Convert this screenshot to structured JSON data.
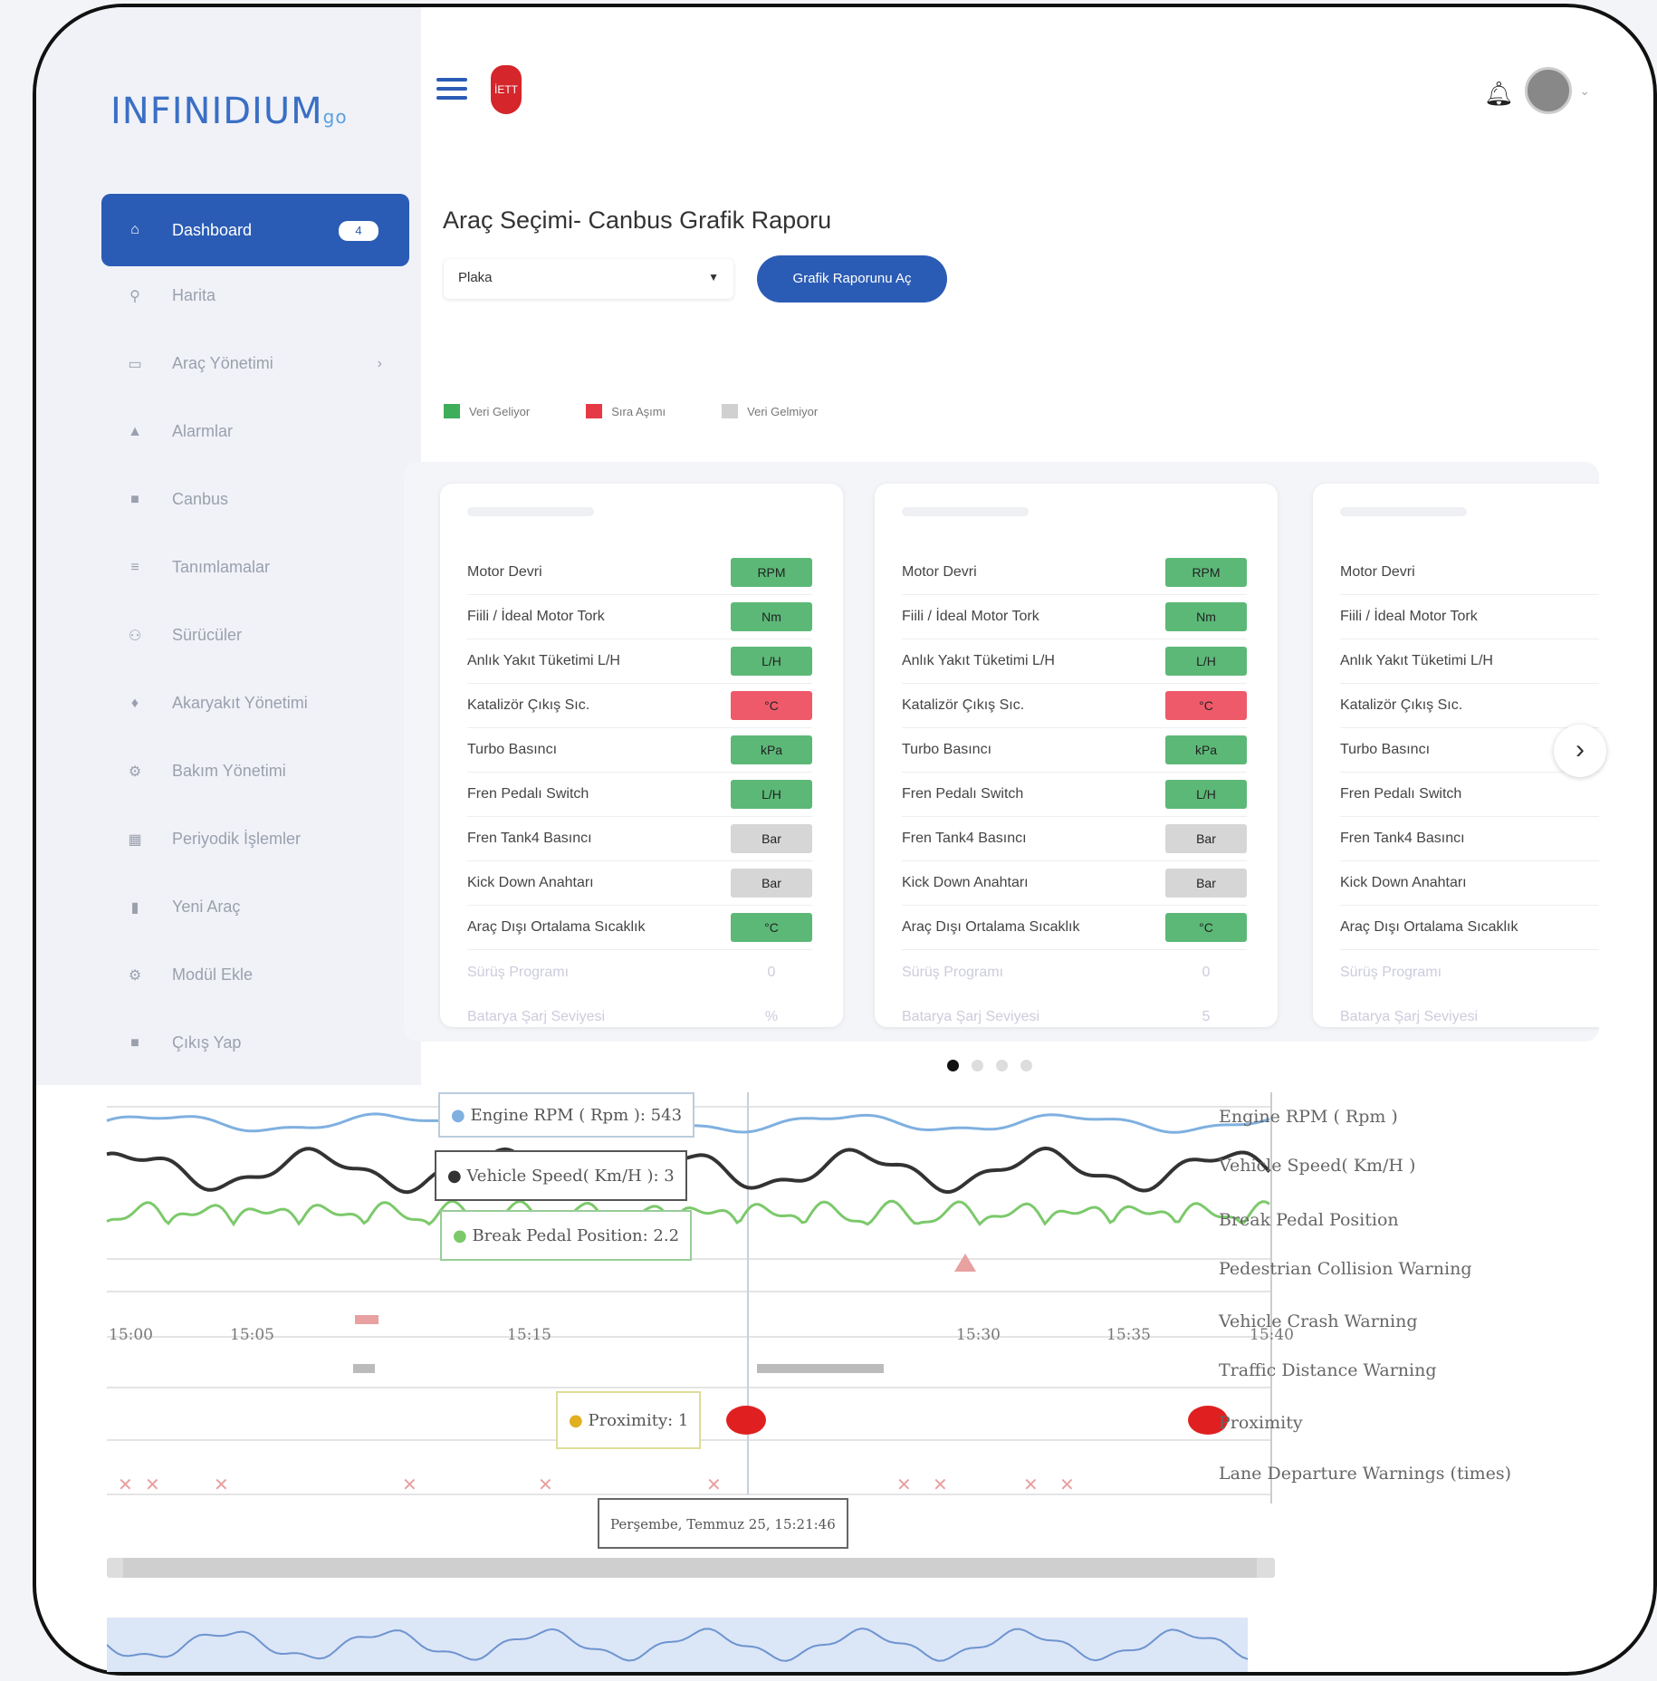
{
  "brand": {
    "logo_main": "INFINIDIUM",
    "logo_suffix": "go"
  },
  "sidebar": {
    "items": [
      {
        "label": "Dashboard",
        "icon": "home-icon",
        "badge": "4"
      },
      {
        "label": "Harita",
        "icon": "map-pin-icon"
      },
      {
        "label": "Araç Yönetimi",
        "icon": "vehicle-icon",
        "chevron": "›"
      },
      {
        "label": "Alarmlar",
        "icon": "alarm-icon"
      },
      {
        "label": "Canbus",
        "icon": "canbus-icon"
      },
      {
        "label": "Tanımlamalar",
        "icon": "list-icon"
      },
      {
        "label": "Sürücüler",
        "icon": "drivers-icon"
      },
      {
        "label": "Akaryakıt Yönetimi",
        "icon": "fuel-icon"
      },
      {
        "label": "Bakım Yönetimi",
        "icon": "maintenance-icon"
      },
      {
        "label": "Periyodik İşlemler",
        "icon": "calendar-icon"
      },
      {
        "label": "Yeni Araç",
        "icon": "new-vehicle-icon"
      },
      {
        "label": "Modül Ekle",
        "icon": "module-icon"
      },
      {
        "label": "Çıkış Yap",
        "icon": "logout-icon"
      }
    ]
  },
  "header": {
    "emblem_text": "İETT"
  },
  "page": {
    "title": "Araç Seçimi- Canbus Grafik Raporu",
    "plate_select": "Plaka",
    "open_button": "Grafik Raporunu Aç",
    "legend": [
      {
        "label": "Veri Geliyor",
        "color": "#3fae5a"
      },
      {
        "label": "Sıra Aşımı",
        "color": "#e63946"
      },
      {
        "label": "Veri Gelmiyor",
        "color": "#d0d0d0"
      }
    ]
  },
  "cards": [
    {
      "rows": [
        {
          "label": "Motor Devri",
          "unit": "RPM",
          "status": "green"
        },
        {
          "label": "Fiili / İdeal Motor Tork",
          "unit": "Nm",
          "status": "green"
        },
        {
          "label": "Anlık Yakıt Tüketimi L/H",
          "unit": "L/H",
          "status": "green"
        },
        {
          "label": "Katalizör Çıkış Sıc.",
          "unit": "°C",
          "status": "red"
        },
        {
          "label": "Turbo Basıncı",
          "unit": "kPa",
          "status": "green"
        },
        {
          "label": "Fren Pedalı Switch",
          "unit": "L/H",
          "status": "green"
        },
        {
          "label": "Fren Tank4 Basıncı",
          "unit": "Bar",
          "status": "gray"
        },
        {
          "label": "Kick Down Anahtarı",
          "unit": "Bar",
          "status": "gray"
        },
        {
          "label": "Araç Dışı Ortalama Sıcaklık",
          "unit": "°C",
          "status": "green"
        }
      ],
      "faded_rows": [
        {
          "label": "Sürüş Programı",
          "value": "0"
        },
        {
          "label": "Batarya Şarj Seviyesi",
          "value": "%"
        }
      ]
    },
    {
      "rows": [
        {
          "label": "Motor Devri",
          "unit": "RPM",
          "status": "green"
        },
        {
          "label": "Fiili / İdeal Motor Tork",
          "unit": "Nm",
          "status": "green"
        },
        {
          "label": "Anlık Yakıt Tüketimi L/H",
          "unit": "L/H",
          "status": "green"
        },
        {
          "label": "Katalizör Çıkış Sıc.",
          "unit": "°C",
          "status": "red"
        },
        {
          "label": "Turbo Basıncı",
          "unit": "kPa",
          "status": "green"
        },
        {
          "label": "Fren Pedalı Switch",
          "unit": "L/H",
          "status": "green"
        },
        {
          "label": "Fren Tank4 Basıncı",
          "unit": "Bar",
          "status": "gray"
        },
        {
          "label": "Kick Down Anahtarı",
          "unit": "Bar",
          "status": "gray"
        },
        {
          "label": "Araç Dışı Ortalama Sıcaklık",
          "unit": "°C",
          "status": "green"
        }
      ],
      "faded_rows": [
        {
          "label": "Sürüş Programı",
          "value": "0"
        },
        {
          "label": "Batarya Şarj Seviyesi",
          "value": "5"
        }
      ]
    },
    {
      "rows": [
        {
          "label": "Motor Devri",
          "unit": "",
          "status": "none"
        },
        {
          "label": "Fiili / İdeal Motor Tork",
          "unit": "",
          "status": "none"
        },
        {
          "label": "Anlık Yakıt Tüketimi L/H",
          "unit": "",
          "status": "none"
        },
        {
          "label": "Katalizör Çıkış Sıc.",
          "unit": "",
          "status": "none"
        },
        {
          "label": "Turbo Basıncı",
          "unit": "",
          "status": "none"
        },
        {
          "label": "Fren Pedalı Switch",
          "unit": "",
          "status": "none"
        },
        {
          "label": "Fren Tank4 Basıncı",
          "unit": "",
          "status": "none"
        },
        {
          "label": "Kick Down Anahtarı",
          "unit": "",
          "status": "none"
        },
        {
          "label": "Araç Dışı Ortalama Sıcaklık",
          "unit": "",
          "status": "none"
        }
      ],
      "faded_rows": [
        {
          "label": "Sürüş Programı",
          "value": ""
        },
        {
          "label": "Batarya Şarj Seviyesi",
          "value": ""
        }
      ]
    }
  ],
  "status_colors": {
    "green": "#5cb877",
    "red": "#ee5a6a",
    "gray": "#d6d6d6",
    "none": "transparent"
  },
  "carousel": {
    "pages": 4,
    "active": 0,
    "next_icon": "chevron-right-icon"
  },
  "chart_data": {
    "type": "line",
    "series": [
      {
        "name": "Engine RPM ( Rpm )",
        "color": "#7fb0e0"
      },
      {
        "name": "Vehicle Speed( Km/H )",
        "color": "#333333"
      },
      {
        "name": "Break Pedal Position",
        "color": "#7cc96b"
      },
      {
        "name": "Pedestrian Collision Warning",
        "color": "#e8a0a0"
      },
      {
        "name": "Vehicle Crash Warning",
        "color": "#e8a0a0"
      },
      {
        "name": "Traffic Distance Warning",
        "color": "#bbbbbb"
      },
      {
        "name": "Proximity",
        "color": "#e02020"
      },
      {
        "name": "Lane Departure Warnings (times)",
        "color": "#e8a0a0"
      }
    ],
    "x_ticks": [
      "15:00",
      "15:05",
      "15:15",
      "15:30",
      "15:35",
      "15:40"
    ],
    "tooltip": {
      "rpm": "Engine RPM ( Rpm ): 543",
      "speed": "Vehicle Speed( Km/H ): 3",
      "brake": "Break Pedal Position: 2.2",
      "proximity": "Proximity: 1",
      "timestamp": "Perşembe, Temmuz 25, 15:21:46"
    }
  }
}
